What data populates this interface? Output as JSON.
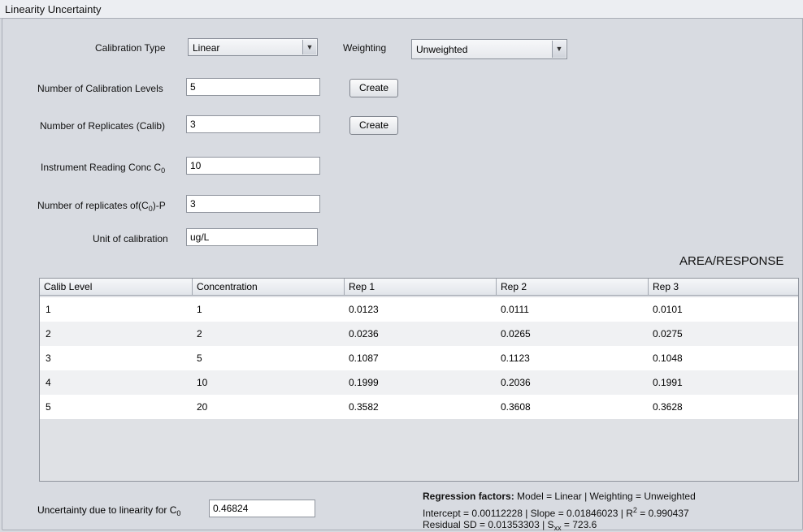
{
  "window": {
    "title": "Linearity Uncertainty"
  },
  "form": {
    "calibration_type_label": "Calibration Type",
    "calibration_type_value": "Linear",
    "weighting_label": "Weighting",
    "weighting_value": "Unweighted",
    "num_levels_label": "Number of Calibration Levels",
    "num_levels_value": "5",
    "num_replicates_label": "Number of Replicates (Calib)",
    "num_replicates_value": "3",
    "instrument_reading_label": "Instrument Reading Conc C",
    "instrument_reading_sub": "0",
    "instrument_reading_value": "10",
    "replicates_c0_label_pre": "Number of replicates of(C",
    "replicates_c0_sub": "0",
    "replicates_c0_label_post": ")-P",
    "replicates_c0_value": "3",
    "unit_label": "Unit of calibration",
    "unit_value": "ug/L",
    "create_label": "Create"
  },
  "table": {
    "title": "AREA/RESPONSE",
    "columns": [
      "Calib Level",
      "Concentration",
      "Rep 1",
      "Rep 2",
      "Rep 3"
    ],
    "rows": [
      [
        "1",
        "1",
        "0.0123",
        "0.0111",
        "0.0101"
      ],
      [
        "2",
        "2",
        "0.0236",
        "0.0265",
        "0.0275"
      ],
      [
        "3",
        "5",
        "0.1087",
        "0.1123",
        "0.1048"
      ],
      [
        "4",
        "10",
        "0.1999",
        "0.2036",
        "0.1991"
      ],
      [
        "5",
        "20",
        "0.3582",
        "0.3608",
        "0.3628"
      ]
    ]
  },
  "footer": {
    "uncertainty_label": "Uncertainty due to linearity for C",
    "uncertainty_sub": "0",
    "uncertainty_value": "0.46824",
    "regression_heading": "Regression factors:",
    "regression_line1": "Model = Linear  |  Weighting = Unweighted",
    "regression_line2_pre": "Intercept = 0.00112228  |  Slope = 0.01846023  |  R",
    "regression_line2_sup": "2",
    "regression_line2_post": " = 0.990437",
    "regression_line3_pre": "Residual SD = 0.01353303  |  S",
    "regression_line3_sub": "xx",
    "regression_line3_post": " = 723.6"
  }
}
